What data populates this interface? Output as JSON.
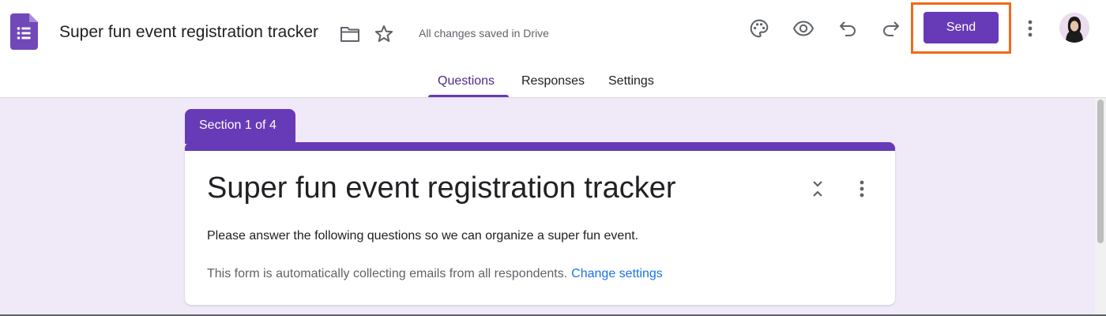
{
  "header": {
    "title": "Super fun event registration tracker",
    "save_status": "All changes saved in Drive",
    "send_label": "Send"
  },
  "tabs": [
    {
      "label": "Questions",
      "active": true
    },
    {
      "label": "Responses",
      "active": false
    },
    {
      "label": "Settings",
      "active": false
    }
  ],
  "section": {
    "label": "Section 1 of 4"
  },
  "form": {
    "title": "Super fun event registration tracker",
    "description": "Please answer the following questions so we can organize a super fun event.",
    "email_note": "This form is automatically collecting emails from all respondents.",
    "change_settings_link": "Change settings"
  },
  "icons": {
    "app": "google-forms-icon",
    "folder": "folder-icon",
    "star": "star-icon",
    "palette": "palette-icon",
    "preview": "eye-icon",
    "undo": "undo-icon",
    "redo": "redo-icon",
    "more": "more-vert-icon",
    "collapse": "collapse-icon"
  },
  "colors": {
    "accent": "#673ab7",
    "canvas": "#efe9f8",
    "highlight": "#f06a1d",
    "link": "#1a73e8"
  }
}
